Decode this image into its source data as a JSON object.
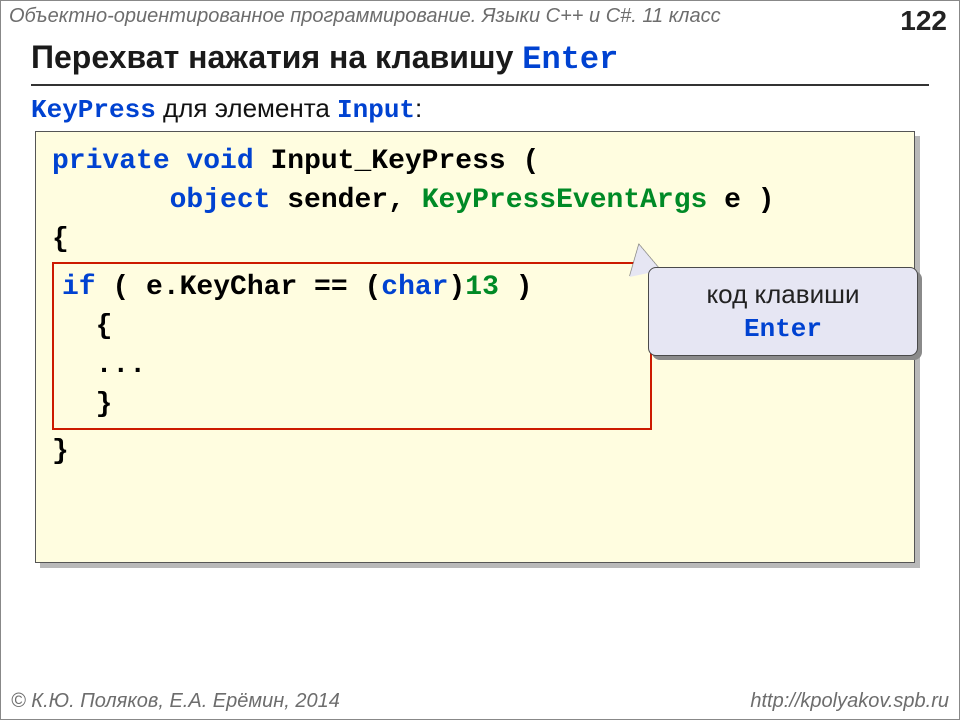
{
  "header": {
    "course": "Объектно-ориентированное программирование. Языки C++ и C#. 11 класс",
    "page": "122"
  },
  "title": {
    "prefix": "Перехват нажатия на клавишу ",
    "mono": "Enter"
  },
  "subtitle": {
    "kw1": "KeyPress",
    "mid": " для элемента ",
    "kw2": "Input",
    "suffix": ":"
  },
  "code": {
    "l1_kw1": "private",
    "l1_kw2": "void",
    "l1_rest": " Input_KeyPress (",
    "l2_indent": "       ",
    "l2_kw": "object",
    "l2_mid": " sender, ",
    "l2_type": "KeyPressEventArgs",
    "l2_end": " e )",
    "l3": "{",
    "inner_kw": "if",
    "inner_mid1": " ( e.KeyChar == (",
    "inner_kw2": "char",
    "inner_mid2": ")",
    "inner_num": "13",
    "inner_end": " )",
    "inner_l2": "  {",
    "inner_l3": "  ...",
    "inner_l4": "  }",
    "l_last": "}"
  },
  "callout": {
    "line1": "код клавиши",
    "line2": "Enter"
  },
  "footer": {
    "left": "© К.Ю. Поляков, Е.А. Ерёмин, 2014",
    "right": "http://kpolyakov.spb.ru"
  }
}
